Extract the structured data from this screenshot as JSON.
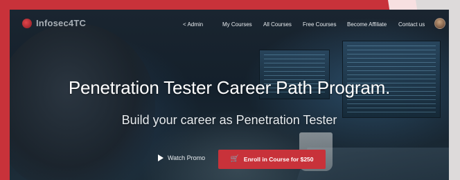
{
  "brand": {
    "name": "Infosec4TC"
  },
  "nav": {
    "items": [
      "< Admin",
      "My Courses",
      "All Courses",
      "Free Courses",
      "Become Affiliate",
      "Contact us"
    ]
  },
  "hero": {
    "title": "Penetration Tester Career Path Program.",
    "subtitle": "Build your career as Penetration Tester"
  },
  "actions": {
    "watch_label": "Watch Promo",
    "enroll_label": "Enroll in Course for $250"
  },
  "icons": {
    "logo": "logo-icon",
    "avatar": "user-avatar",
    "play": "play-icon",
    "cart": "cart-icon"
  },
  "colors": {
    "accent": "#c8323a",
    "text": "#ffffff",
    "frame": "#c8323a"
  }
}
